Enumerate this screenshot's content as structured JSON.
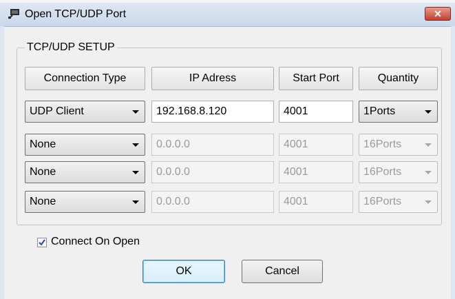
{
  "window": {
    "title": "Open TCP/UDP Port",
    "close_label": "✕",
    "icon": "network-port-icon"
  },
  "group": {
    "legend": "TCP/UDP SETUP",
    "headers": {
      "connection_type": "Connection Type",
      "ip_address": "IP Adress",
      "start_port": "Start Port",
      "quantity": "Quantity"
    },
    "rows": [
      {
        "type": "UDP Client",
        "ip": "192.168.8.120",
        "port": "4001",
        "quantity": "1Ports",
        "enabled": true
      },
      {
        "type": "None",
        "ip": "0.0.0.0",
        "port": "4001",
        "quantity": "16Ports",
        "enabled": false
      },
      {
        "type": "None",
        "ip": "0.0.0.0",
        "port": "4001",
        "quantity": "16Ports",
        "enabled": false
      },
      {
        "type": "None",
        "ip": "0.0.0.0",
        "port": "4001",
        "quantity": "16Ports",
        "enabled": false
      }
    ]
  },
  "options": {
    "connect_on_open_label": "Connect On Open",
    "connect_on_open_checked": true
  },
  "buttons": {
    "ok": "OK",
    "cancel": "Cancel"
  }
}
